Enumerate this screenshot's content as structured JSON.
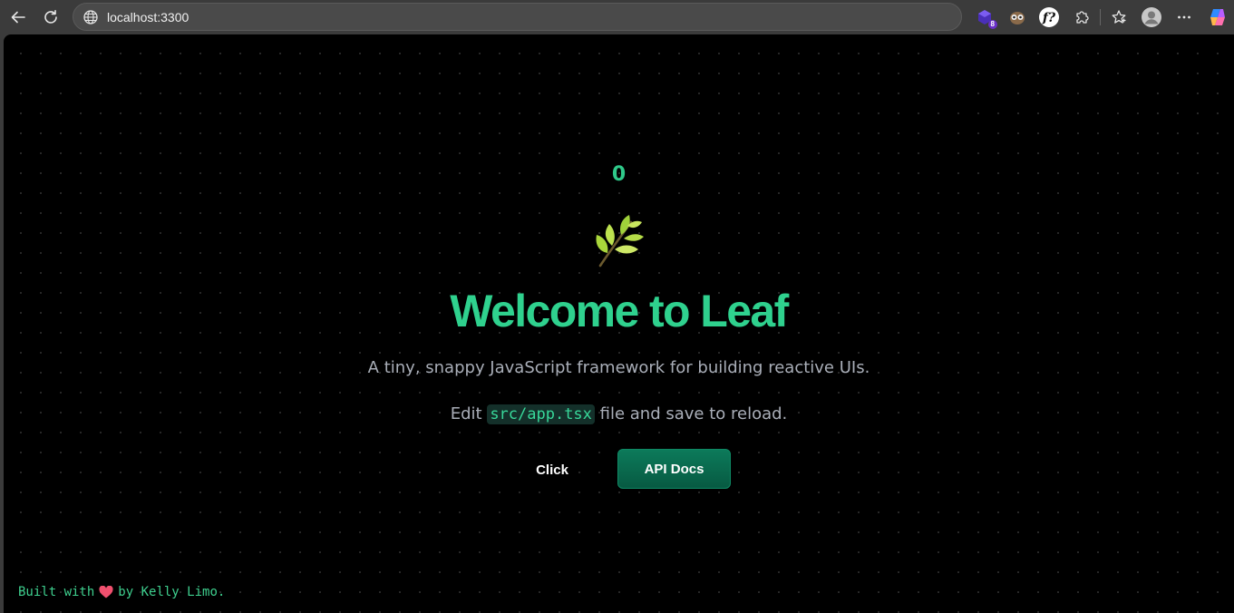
{
  "browser": {
    "url": "localhost:3300",
    "extension_badge_count": "8",
    "icons": {
      "back": "arrow-left-icon",
      "reload": "reload-icon",
      "site_info": "globe-icon",
      "extension_1": "extension-cube-icon",
      "extension_2": "owl-extension-icon",
      "extension_3": "font-finder-icon",
      "extensions": "puzzle-icon",
      "favorites": "star-icon",
      "profile": "avatar-icon",
      "more": "more-icon",
      "copilot": "copilot-icon"
    }
  },
  "page": {
    "counter": "0",
    "logo_icon": "leaf-icon",
    "headline": "Welcome to Leaf",
    "subtitle": "A tiny, snappy JavaScript framework for building reactive UIs.",
    "edit_prefix": "Edit ",
    "edit_code": "src/app.tsx",
    "edit_suffix": " file and save to reload.",
    "buttons": {
      "click_label": "Click",
      "docs_label": "API Docs"
    },
    "footer": {
      "prefix": "Built with",
      "heart_icon": "heart-icon",
      "suffix": "by Kelly Limo."
    }
  },
  "colors": {
    "accent_green": "#2fd18e",
    "docs_button": "#0c7a5a",
    "background": "#000000"
  }
}
